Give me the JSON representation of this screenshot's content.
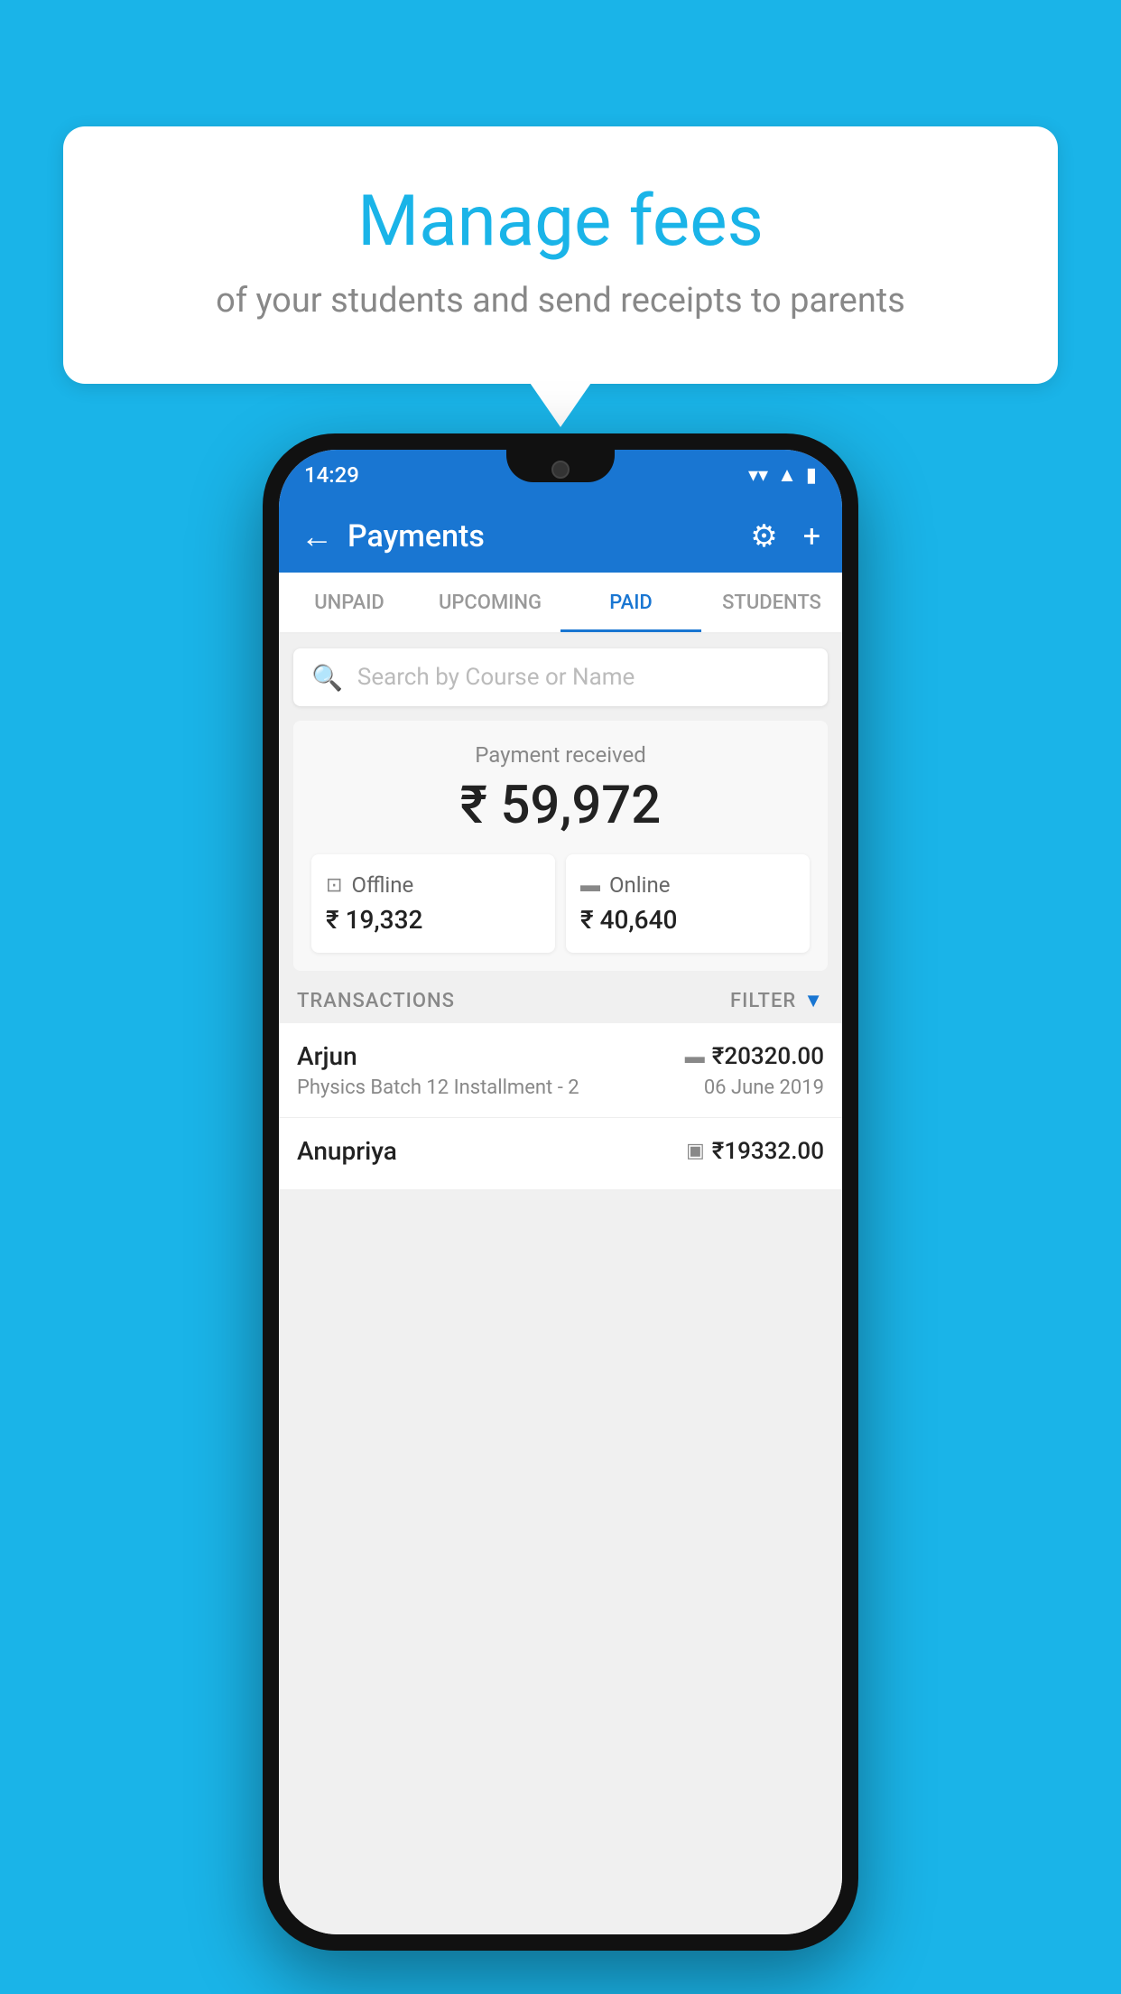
{
  "page": {
    "background_color": "#1ab4e8"
  },
  "bubble": {
    "title": "Manage fees",
    "subtitle": "of your students and send receipts to parents"
  },
  "status_bar": {
    "time": "14:29",
    "wifi_icon": "▼",
    "signal_icon": "▲",
    "battery_icon": "▮"
  },
  "app_bar": {
    "back_label": "←",
    "title": "Payments",
    "gear_label": "⚙",
    "plus_label": "+"
  },
  "tabs": [
    {
      "id": "unpaid",
      "label": "UNPAID",
      "active": false
    },
    {
      "id": "upcoming",
      "label": "UPCOMING",
      "active": false
    },
    {
      "id": "paid",
      "label": "PAID",
      "active": true
    },
    {
      "id": "students",
      "label": "STUDENTS",
      "active": false
    }
  ],
  "search": {
    "placeholder": "Search by Course or Name"
  },
  "payment_summary": {
    "label": "Payment received",
    "amount": "₹ 59,972",
    "offline": {
      "label": "Offline",
      "amount": "₹ 19,332"
    },
    "online": {
      "label": "Online",
      "amount": "₹ 40,640"
    }
  },
  "transactions": {
    "label": "TRANSACTIONS",
    "filter_label": "FILTER",
    "items": [
      {
        "name": "Arjun",
        "type_icon": "▬",
        "amount": "₹20320.00",
        "course": "Physics Batch 12 Installment - 2",
        "date": "06 June 2019"
      },
      {
        "name": "Anupriya",
        "type_icon": "▣",
        "amount": "₹19332.00",
        "course": "",
        "date": ""
      }
    ]
  }
}
